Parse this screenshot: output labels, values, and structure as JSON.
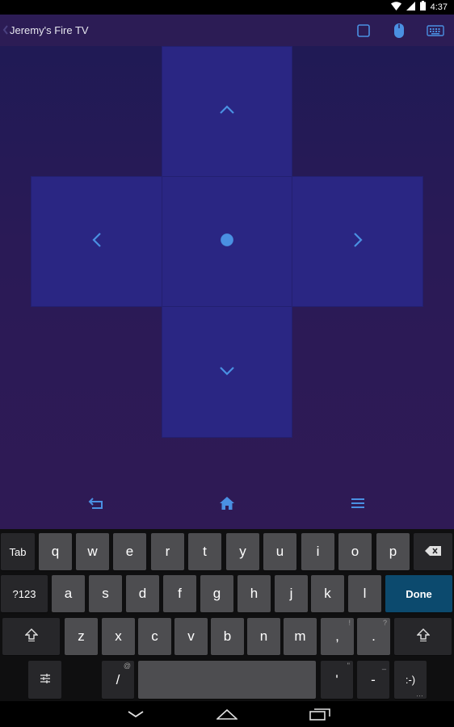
{
  "status_bar": {
    "time": "4:37",
    "icons": [
      "wifi-icon",
      "signal-icon",
      "battery-icon"
    ]
  },
  "action_bar": {
    "title": "Jeremy's Fire TV",
    "icons": [
      "back-chevron-icon",
      "square-icon",
      "mouse-icon",
      "keyboard-icon"
    ]
  },
  "dpad": {
    "icons": [
      "arrow-up-icon",
      "arrow-left-icon",
      "select-circle-icon",
      "arrow-right-icon",
      "arrow-down-icon"
    ]
  },
  "bottom_controls": {
    "icons": [
      "back-icon",
      "home-icon",
      "menu-icon"
    ]
  },
  "keyboard": {
    "row1": [
      "Tab",
      "q",
      "w",
      "e",
      "r",
      "t",
      "y",
      "u",
      "i",
      "o",
      "p"
    ],
    "row2": [
      "?123",
      "a",
      "s",
      "d",
      "f",
      "g",
      "h",
      "j",
      "k",
      "l",
      "Done"
    ],
    "row3": [
      "z",
      "x",
      "c",
      "v",
      "b",
      "n",
      "m",
      ",",
      "."
    ],
    "row3_hints": [
      "!",
      "?"
    ],
    "row4": [
      "/",
      "'",
      "-",
      ":-)"
    ],
    "row4_hints": [
      "@",
      "\"",
      "_",
      "…"
    ],
    "icons": [
      "backspace-icon",
      "shift-left-icon",
      "shift-right-icon",
      "settings-sliders-icon",
      "spacebar"
    ]
  },
  "navigation_bar": {
    "icons": [
      "nav-back-icon",
      "nav-home-icon",
      "nav-recents-icon"
    ]
  },
  "colors": {
    "accent": "#4a90e2",
    "dpad": "#2a2683",
    "done_key": "#0c4a6e"
  }
}
